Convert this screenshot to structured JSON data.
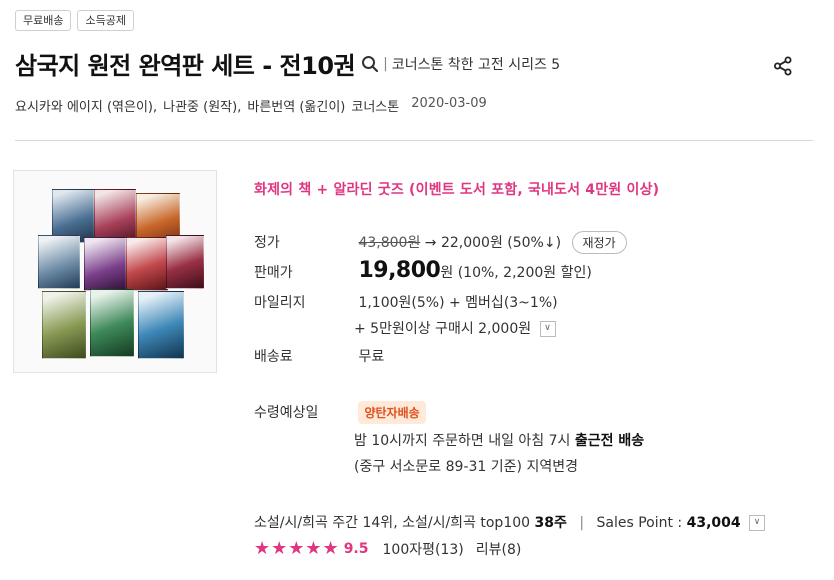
{
  "tags": [
    "무료배송",
    "소득공제"
  ],
  "title": "삼국지 원전 완역판 세트 - 전10권",
  "series_separator": "|",
  "series": "코너스톤 착한 고전 시리즈 5",
  "authors": [
    "요시카와 에이지 (엮은이),",
    "나관중 (원작),",
    "바른번역 (옮긴이)",
    "코너스톤"
  ],
  "date": "2020-03-09",
  "promo": "화제의 책 + 알라딘 굿즈 (이벤트 도서 포함, 국내도서 4만원 이상)",
  "list_price": {
    "label": "정가",
    "original": "43,800원",
    "arrow": "→",
    "sale": "22,000원 (50%↓)",
    "button": "재정가"
  },
  "sale_price": {
    "label": "판매가",
    "amount": "19,800",
    "unit": "원",
    "detail": "(10%, 2,200원 할인)"
  },
  "mileage": {
    "label": "마일리지",
    "line1": "1,100원(5%) + 멤버십(3~1%)",
    "line2": "+ 5만원이상 구매시 2,000원"
  },
  "shipping_fee": {
    "label": "배송료",
    "value": "무료"
  },
  "delivery": {
    "label": "수령예상일",
    "badge": "양탄자배송",
    "line1_prefix": "밤 10시까지 주문하면 내일 아침 7시 ",
    "line1_strong": "출근전 배송",
    "line2": "(중구 서소문로 89-31 기준) 지역변경"
  },
  "ranking": {
    "text": "소설/시/희곡 주간 14위, 소설/시/희곡 top100 ",
    "weeks": "38주",
    "pipe": "|",
    "sales_label": "Sales Point : ",
    "sales_value": "43,004"
  },
  "rating": {
    "stars": "★★★★★",
    "score": "9.5",
    "short_reviews": "100자평(13)",
    "reviews": "리뷰(8)"
  },
  "colors": {
    "accent_pink": "#e03681",
    "badge_orange": "#e0501f"
  }
}
